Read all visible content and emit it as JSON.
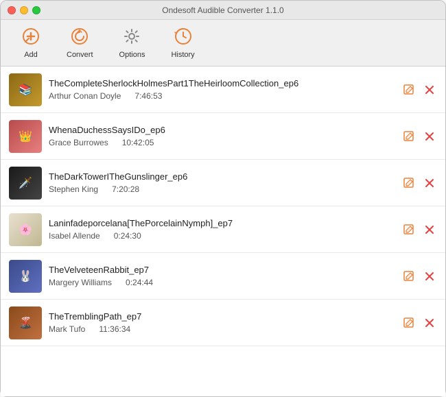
{
  "window": {
    "title": "Ondesoft Audible Converter 1.1.0"
  },
  "toolbar": {
    "buttons": [
      {
        "id": "add",
        "label": "Add",
        "icon": "➕",
        "icon_type": "add"
      },
      {
        "id": "convert",
        "label": "Convert",
        "icon": "🔄",
        "icon_type": "convert"
      },
      {
        "id": "options",
        "label": "Options",
        "icon": "⚙️",
        "icon_type": "options"
      },
      {
        "id": "history",
        "label": "History",
        "icon": "🕐",
        "icon_type": "history"
      }
    ]
  },
  "books": [
    {
      "id": 1,
      "title": "TheCompleteSherlockHolmesPart1TheHeirloomCollection_ep6",
      "author": "Arthur Conan Doyle",
      "duration": "7:46:53",
      "cover_class": "cover-1",
      "cover_emoji": "📚"
    },
    {
      "id": 2,
      "title": "WhenaDuchessSaysIDo_ep6",
      "author": "Grace Burrowes",
      "duration": "10:42:05",
      "cover_class": "cover-2",
      "cover_emoji": "👑"
    },
    {
      "id": 3,
      "title": "TheDarkTowerITheGunslinger_ep6",
      "author": "Stephen King",
      "duration": "7:20:28",
      "cover_class": "cover-3",
      "cover_emoji": "🗡️"
    },
    {
      "id": 4,
      "title": "Laninfadeporcelana[ThePorcelainNymph]_ep7",
      "author": "Isabel Allende",
      "duration": "0:24:30",
      "cover_class": "cover-4",
      "cover_emoji": "🌸"
    },
    {
      "id": 5,
      "title": "TheVelveteenRabbit_ep7",
      "author": "Margery Williams",
      "duration": "0:24:44",
      "cover_class": "cover-5",
      "cover_emoji": "🐰"
    },
    {
      "id": 6,
      "title": "TheTremblingPath_ep7",
      "author": "Mark Tufo",
      "duration": "11:36:34",
      "cover_class": "cover-6",
      "cover_emoji": "🌋"
    }
  ],
  "actions": {
    "edit_label": "✎",
    "delete_label": "✕"
  }
}
